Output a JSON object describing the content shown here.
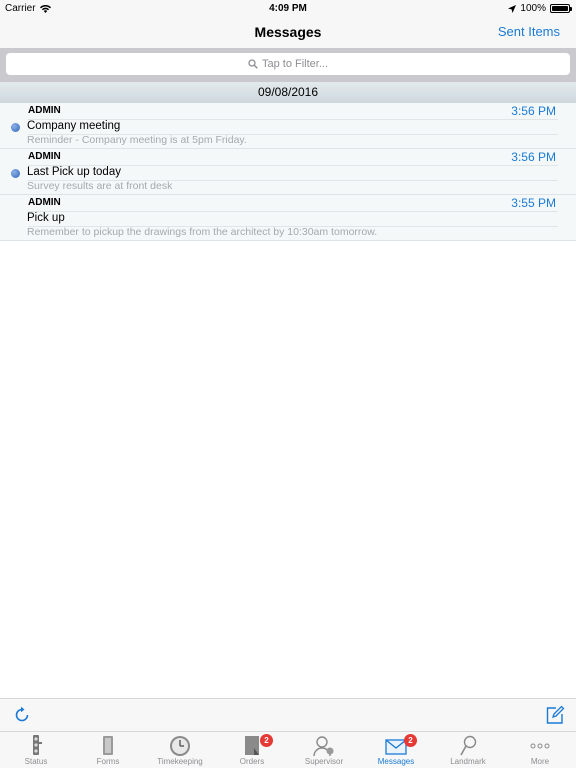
{
  "status_bar": {
    "carrier": "Carrier",
    "time": "4:09 PM",
    "battery": "100%",
    "battery_level": 1.0
  },
  "nav": {
    "title": "Messages",
    "sent_items": "Sent Items"
  },
  "search": {
    "placeholder": "Tap to Filter..."
  },
  "date_header": "09/08/2016",
  "messages": [
    {
      "sender": "ADMIN",
      "time": "3:56 PM",
      "subject": "Company meeting",
      "body": "Reminder - Company meeting is at 5pm Friday.",
      "unread": true
    },
    {
      "sender": "ADMIN",
      "time": "3:56 PM",
      "subject": "Last Pick up today",
      "body": "Survey results are at front desk",
      "unread": true
    },
    {
      "sender": "ADMIN",
      "time": "3:55 PM",
      "subject": "Pick up",
      "body": "Remember to pickup the drawings from the architect by 10:30am tomorrow.",
      "unread": false
    }
  ],
  "tabs": [
    {
      "label": "Status",
      "icon": "traffic-light-icon",
      "badge": ""
    },
    {
      "label": "Forms",
      "icon": "forms-icon",
      "badge": ""
    },
    {
      "label": "Timekeeping",
      "icon": "clock-icon",
      "badge": ""
    },
    {
      "label": "Orders",
      "icon": "orders-icon",
      "badge": "2"
    },
    {
      "label": "Supervisor",
      "icon": "supervisor-icon",
      "badge": ""
    },
    {
      "label": "Messages",
      "icon": "envelope-icon",
      "badge": "2",
      "active": true
    },
    {
      "label": "Landmark",
      "icon": "pushpin-icon",
      "badge": ""
    },
    {
      "label": "More",
      "icon": "more-dots-icon",
      "badge": ""
    }
  ],
  "colors": {
    "accent": "#1a7ad6",
    "badge": "#e53935",
    "unread_dot": "#2f62b8"
  }
}
